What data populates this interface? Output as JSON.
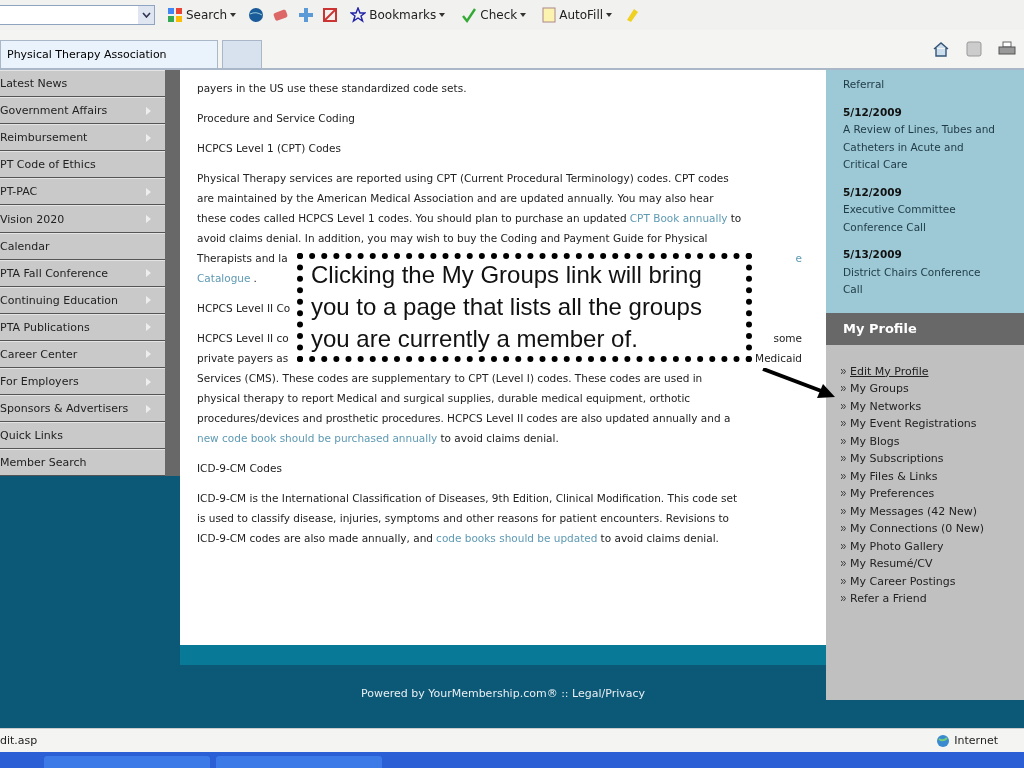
{
  "toolbar": {
    "items": [
      {
        "kind": "search",
        "label": "Search"
      },
      {
        "kind": "icons"
      },
      {
        "kind": "bookmarks",
        "label": "Bookmarks"
      },
      {
        "kind": "check",
        "label": "Check"
      },
      {
        "kind": "autofill",
        "label": "AutoFill"
      }
    ]
  },
  "tabs": [
    {
      "label": "Physical Therapy Association",
      "selected": true
    },
    {
      "selected": false
    }
  ],
  "menu": [
    {
      "label": "Latest News",
      "submenu": false
    },
    {
      "label": "Government Affairs",
      "submenu": true
    },
    {
      "label": "Reimbursement",
      "submenu": true
    },
    {
      "label": "PT Code of Ethics",
      "submenu": false
    },
    {
      "label": "PT-PAC",
      "submenu": true
    },
    {
      "label": "Vision 2020",
      "submenu": true
    },
    {
      "label": "Calendar",
      "submenu": false
    },
    {
      "label": "PTA Fall Conference",
      "submenu": true
    },
    {
      "label": "Continuing Education",
      "submenu": true
    },
    {
      "label": "PTA Publications",
      "submenu": true
    },
    {
      "label": "Career Center",
      "submenu": true
    },
    {
      "label": "For Employers",
      "submenu": true
    },
    {
      "label": "Sponsors & Advertisers",
      "submenu": true
    },
    {
      "label": "Quick Links",
      "submenu": false
    },
    {
      "label": "Member Search",
      "submenu": false
    }
  ],
  "content": [
    {
      "lines": [
        {
          "left": [
            {
              "text": "payers in the US use these standardized code sets.",
              "link": false
            }
          ]
        }
      ]
    },
    {
      "lines": [
        {
          "left": [
            {
              "text": "Procedure and Service Coding",
              "link": false
            }
          ]
        }
      ]
    },
    {
      "lines": [
        {
          "left": [
            {
              "text": "HCPCS Level 1 (CPT) Codes",
              "link": false
            }
          ]
        }
      ]
    },
    {
      "lines": [
        {
          "left": [
            {
              "text": "Physical Therapy services are reported using CPT (Current Procedural Terminology) codes. CPT codes",
              "link": false
            }
          ]
        },
        {
          "left": [
            {
              "text": "are maintained by the American Medical Association and are updated annually. You may also hear",
              "link": false
            }
          ]
        },
        {
          "left": [
            {
              "text": "these codes called HCPCS Level 1 codes. You should plan to purchase an updated",
              "link": false
            },
            {
              "text": "CPT Book annually",
              "link": true
            },
            {
              "text": "to",
              "link": false
            }
          ]
        },
        {
          "left": [
            {
              "text": "avoid claims denial. In addition, you may wish to buy the Coding and Payment Guide for Physical",
              "link": false
            }
          ]
        },
        {
          "left": [
            {
              "text": "Therapists and la",
              "link": false
            }
          ],
          "right": [
            {
              "text": "e",
              "link": true
            }
          ]
        },
        {
          "left": [
            {
              "text": "Catalogue",
              "link": true
            },
            {
              "text": ".",
              "link": false
            }
          ]
        }
      ]
    },
    {
      "lines": [
        {
          "left": [
            {
              "text": "HCPCS Level II Co",
              "link": false
            }
          ]
        }
      ]
    },
    {
      "lines": [
        {
          "left": [
            {
              "text": "HCPCS Level II co",
              "link": false
            }
          ],
          "right": [
            {
              "text": "some",
              "link": false
            }
          ]
        },
        {
          "left": [
            {
              "text": "private payers as",
              "link": false
            }
          ],
          "right": [
            {
              "text": "Medicaid",
              "link": false
            }
          ]
        },
        {
          "left": [
            {
              "text": "Services (CMS). These codes are supplementary to CPT (Level I) codes. These codes are used in",
              "link": false
            }
          ]
        },
        {
          "left": [
            {
              "text": "physical therapy to report Medical and surgical supplies, durable medical equipment, orthotic",
              "link": false
            }
          ]
        },
        {
          "left": [
            {
              "text": "procedures/devices and prosthetic procedures. HCPCS Level II codes are also updated annually and a",
              "link": false
            }
          ]
        },
        {
          "left": [
            {
              "text": "new code book should be purchased annually",
              "link": true
            },
            {
              "text": "to avoid claims denial.",
              "link": false
            }
          ]
        }
      ]
    },
    {
      "lines": [
        {
          "left": [
            {
              "text": "ICD-9-CM Codes",
              "link": false
            }
          ]
        }
      ]
    },
    {
      "lines": [
        {
          "left": [
            {
              "text": "ICD-9-CM is the International Classification of Diseases, 9th Edition, Clinical Modification. This code set",
              "link": false
            }
          ]
        },
        {
          "left": [
            {
              "text": "is used to classify disease, injuries, symptoms and other reasons for patient encounters. Revisions to",
              "link": false
            }
          ]
        },
        {
          "left": [
            {
              "text": "ICD-9-CM codes are also made annually, and",
              "link": false
            },
            {
              "text": "code books should be updated",
              "link": true
            },
            {
              "text": "to avoid claims denial.",
              "link": false
            }
          ]
        }
      ]
    }
  ],
  "callout": {
    "text": "Clicking the My Groups link will bring you to a page that lists all the groups you are currently a member of."
  },
  "events": {
    "continued": "Referral",
    "items": [
      {
        "date": "5/12/2009",
        "title": "A Review of Lines, Tubes and Catheters in Acute and Critical Care"
      },
      {
        "date": "5/12/2009",
        "title": "Executive Committee Conference Call"
      },
      {
        "date": "5/13/2009",
        "title": "District Chairs Conference Call"
      }
    ]
  },
  "profile": {
    "title": "My Profile",
    "links": [
      {
        "label": "Edit My Profile",
        "underlined": true
      },
      {
        "label": "My Groups",
        "underlined": false
      },
      {
        "label": "My Networks",
        "underlined": false
      },
      {
        "label": "My Event Registrations",
        "underlined": false
      },
      {
        "label": "My Blogs",
        "underlined": false
      },
      {
        "label": "My Subscriptions",
        "underlined": false
      },
      {
        "label": "My Files & Links",
        "underlined": false
      },
      {
        "label": "My Preferences",
        "underlined": false
      },
      {
        "label": "My Messages (42 New)",
        "underlined": false
      },
      {
        "label": "My Connections (0 New)",
        "underlined": false
      },
      {
        "label": "My Photo Gallery",
        "underlined": false
      },
      {
        "label": "My Resumé/CV",
        "underlined": false
      },
      {
        "label": "My Career Postings",
        "underlined": false
      },
      {
        "label": "Refer a Friend",
        "underlined": false
      }
    ]
  },
  "footer": {
    "text": "Powered by YourMembership.com® :: Legal/Privacy"
  },
  "status_bar": {
    "url": "dit.asp",
    "zone": "Internet"
  }
}
